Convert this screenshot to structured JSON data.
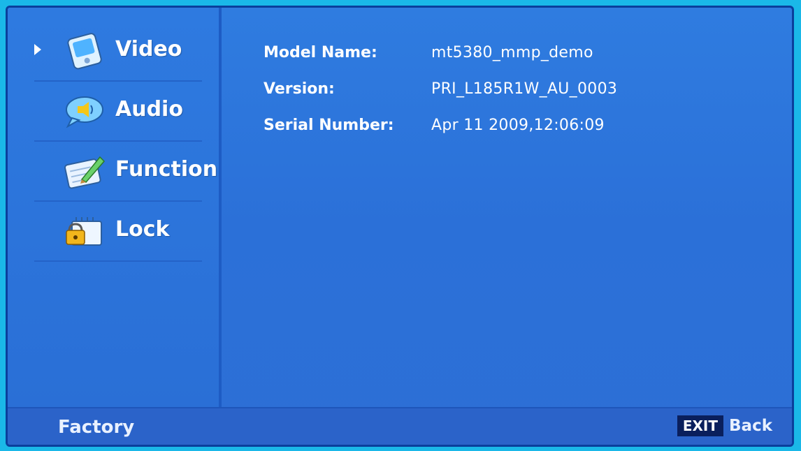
{
  "menu": {
    "items": [
      {
        "label": "Video",
        "icon": "video-icon",
        "selected": true
      },
      {
        "label": "Audio",
        "icon": "audio-icon",
        "selected": false
      },
      {
        "label": "Function",
        "icon": "function-icon",
        "selected": false
      },
      {
        "label": "Lock",
        "icon": "lock-icon",
        "selected": false
      }
    ]
  },
  "info": {
    "model_name_label": "Model Name:",
    "model_name_value": "mt5380_mmp_demo",
    "version_label": "Version:",
    "version_value": "PRI_L185R1W_AU_0003",
    "serial_label": "Serial Number:",
    "serial_value": "Apr 11 2009,12:06:09"
  },
  "footer": {
    "title": "Factory",
    "exit_key": "EXIT",
    "exit_label": "Back"
  },
  "colors": {
    "background": "#2f7ce0",
    "outer": "#1ab8e8",
    "footer": "#2b63c9",
    "text": "#ffffff"
  }
}
